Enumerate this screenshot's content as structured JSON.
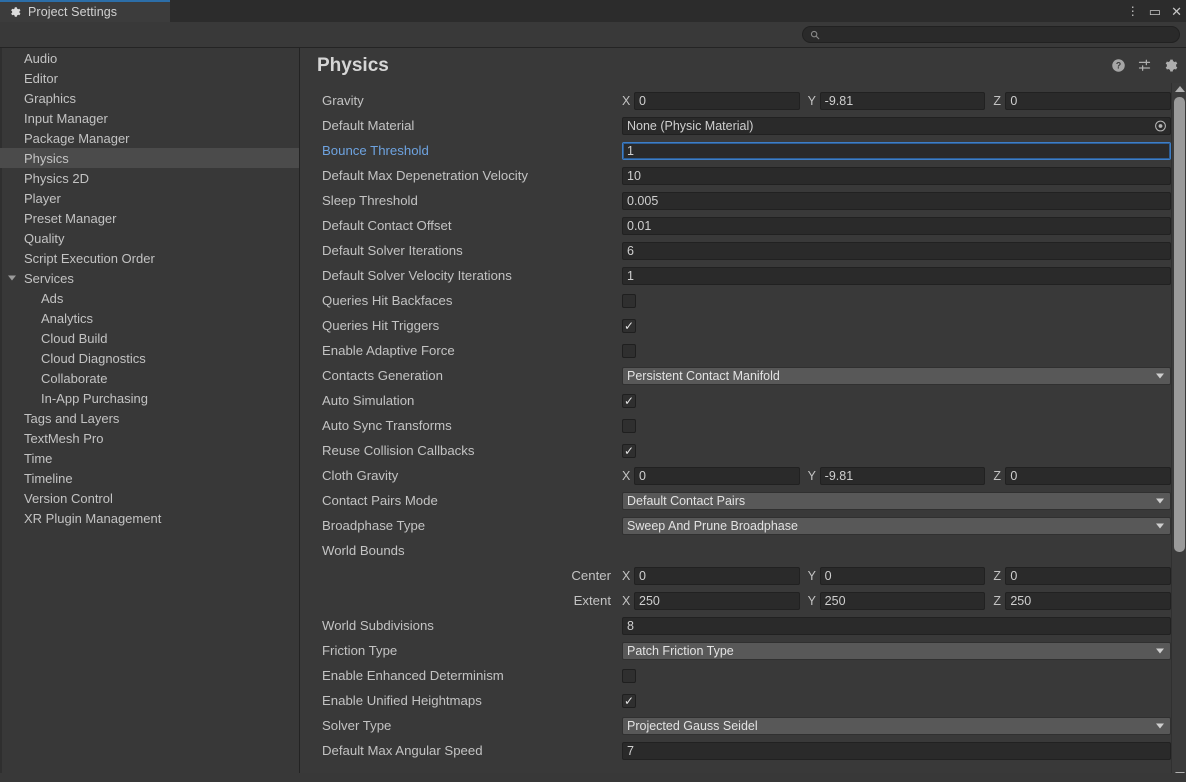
{
  "window": {
    "tab_label": "Project Settings",
    "tab_icon": "gear-icon",
    "controls": {
      "menu": "⋮",
      "maximize": "▭",
      "close": "✕"
    }
  },
  "search": {
    "placeholder": "",
    "value": "",
    "icon": "search-icon"
  },
  "sidebar": {
    "items": [
      {
        "label": "Audio",
        "level": 0,
        "selected": false
      },
      {
        "label": "Editor",
        "level": 0,
        "selected": false
      },
      {
        "label": "Graphics",
        "level": 0,
        "selected": false
      },
      {
        "label": "Input Manager",
        "level": 0,
        "selected": false
      },
      {
        "label": "Package Manager",
        "level": 0,
        "selected": false
      },
      {
        "label": "Physics",
        "level": 0,
        "selected": true
      },
      {
        "label": "Physics 2D",
        "level": 0,
        "selected": false
      },
      {
        "label": "Player",
        "level": 0,
        "selected": false
      },
      {
        "label": "Preset Manager",
        "level": 0,
        "selected": false
      },
      {
        "label": "Quality",
        "level": 0,
        "selected": false
      },
      {
        "label": "Script Execution Order",
        "level": 0,
        "selected": false
      },
      {
        "label": "Services",
        "level": 0,
        "selected": false,
        "expanded": true
      },
      {
        "label": "Ads",
        "level": 1,
        "selected": false
      },
      {
        "label": "Analytics",
        "level": 1,
        "selected": false
      },
      {
        "label": "Cloud Build",
        "level": 1,
        "selected": false
      },
      {
        "label": "Cloud Diagnostics",
        "level": 1,
        "selected": false
      },
      {
        "label": "Collaborate",
        "level": 1,
        "selected": false
      },
      {
        "label": "In-App Purchasing",
        "level": 1,
        "selected": false
      },
      {
        "label": "Tags and Layers",
        "level": 0,
        "selected": false
      },
      {
        "label": "TextMesh Pro",
        "level": 0,
        "selected": false
      },
      {
        "label": "Time",
        "level": 0,
        "selected": false
      },
      {
        "label": "Timeline",
        "level": 0,
        "selected": false
      },
      {
        "label": "Version Control",
        "level": 0,
        "selected": false
      },
      {
        "label": "XR Plugin Management",
        "level": 0,
        "selected": false
      }
    ]
  },
  "main": {
    "title": "Physics",
    "header_icons": [
      "help-icon",
      "preset-icon",
      "gear-icon"
    ],
    "axis_letters": {
      "x": "X",
      "y": "Y",
      "z": "Z"
    },
    "rows": [
      {
        "label": "Gravity",
        "type": "vector3",
        "x": "0",
        "y": "-9.81",
        "z": "0"
      },
      {
        "label": "Default Material",
        "type": "object",
        "value": "None (Physic Material)"
      },
      {
        "label": "Bounce Threshold",
        "type": "text",
        "value": "1",
        "focused": true
      },
      {
        "label": "Default Max Depenetration Velocity",
        "type": "text",
        "value": "10"
      },
      {
        "label": "Sleep Threshold",
        "type": "text",
        "value": "0.005"
      },
      {
        "label": "Default Contact Offset",
        "type": "text",
        "value": "0.01"
      },
      {
        "label": "Default Solver Iterations",
        "type": "text",
        "value": "6"
      },
      {
        "label": "Default Solver Velocity Iterations",
        "type": "text",
        "value": "1"
      },
      {
        "label": "Queries Hit Backfaces",
        "type": "checkbox",
        "checked": false
      },
      {
        "label": "Queries Hit Triggers",
        "type": "checkbox",
        "checked": true
      },
      {
        "label": "Enable Adaptive Force",
        "type": "checkbox",
        "checked": false
      },
      {
        "label": "Contacts Generation",
        "type": "dropdown",
        "value": "Persistent Contact Manifold"
      },
      {
        "label": "Auto Simulation",
        "type": "checkbox",
        "checked": true
      },
      {
        "label": "Auto Sync Transforms",
        "type": "checkbox",
        "checked": false
      },
      {
        "label": "Reuse Collision Callbacks",
        "type": "checkbox",
        "checked": true
      },
      {
        "label": "Cloth Gravity",
        "type": "vector3",
        "x": "0",
        "y": "-9.81",
        "z": "0"
      },
      {
        "label": "Contact Pairs Mode",
        "type": "dropdown",
        "value": "Default Contact Pairs"
      },
      {
        "label": "Broadphase Type",
        "type": "dropdown",
        "value": "Sweep And Prune Broadphase"
      },
      {
        "label": "World Bounds",
        "type": "header"
      },
      {
        "label": "Center",
        "type": "vector3-sub",
        "x": "0",
        "y": "0",
        "z": "0"
      },
      {
        "label": "Extent",
        "type": "vector3-sub",
        "x": "250",
        "y": "250",
        "z": "250"
      },
      {
        "label": "World Subdivisions",
        "type": "text",
        "value": "8"
      },
      {
        "label": "Friction Type",
        "type": "dropdown",
        "value": "Patch Friction Type"
      },
      {
        "label": "Enable Enhanced Determinism",
        "type": "checkbox",
        "checked": false
      },
      {
        "label": "Enable Unified Heightmaps",
        "type": "checkbox",
        "checked": true
      },
      {
        "label": "Solver Type",
        "type": "dropdown",
        "value": "Projected Gauss Seidel"
      },
      {
        "label": "Default Max Angular Speed",
        "type": "text",
        "value": "7"
      }
    ]
  },
  "scrollbar": {
    "name": "vertical-scrollbar",
    "up": "▲",
    "down": "▼"
  },
  "colors": {
    "accent_blue": "#6ea3e0",
    "tab_active": "#2c6ea8",
    "panel_bg": "#393939",
    "input_bg": "#2a2a2a",
    "dropdown_bg": "#585858",
    "selected_row": "#4b4b4b"
  }
}
